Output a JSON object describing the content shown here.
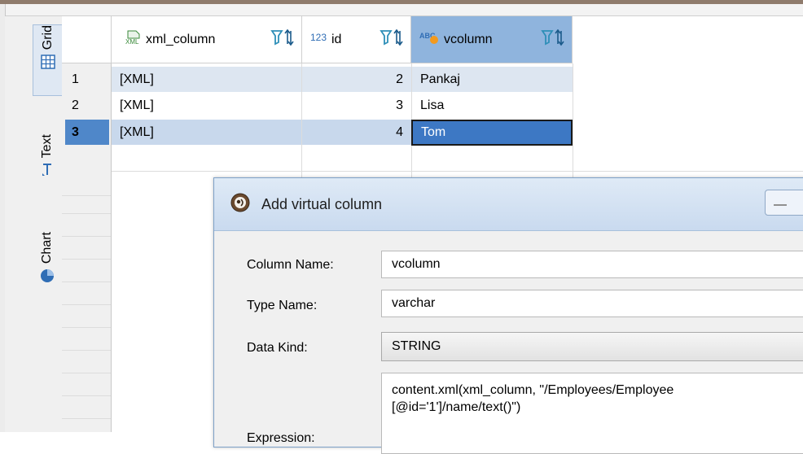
{
  "side_tabs": [
    {
      "label": "Grid",
      "icon": "grid-icon",
      "active": true
    },
    {
      "label": "Text",
      "icon": "text-icon",
      "active": false
    },
    {
      "label": "Chart",
      "icon": "pie-chart-icon",
      "active": false
    }
  ],
  "grid": {
    "columns": [
      {
        "label": "xml_column",
        "icon": "xml-type-icon",
        "type_badge": "XML"
      },
      {
        "label": "id",
        "icon": "number-type-icon",
        "type_badge": "123"
      },
      {
        "label": "vcolumn",
        "icon": "string-type-icon",
        "type_badge": "ABC"
      }
    ],
    "rows": [
      {
        "num": "1",
        "xml_column": "[XML]",
        "id": "2",
        "vcolumn": "Pankaj"
      },
      {
        "num": "2",
        "xml_column": "[XML]",
        "id": "3",
        "vcolumn": "Lisa"
      },
      {
        "num": "3",
        "xml_column": "[XML]",
        "id": "4",
        "vcolumn": "Tom"
      }
    ],
    "selected_row": 3,
    "selected_column": "vcolumn"
  },
  "dialog": {
    "title": "Add virtual column",
    "fields": {
      "column_name_label": "Column Name:",
      "column_name_value": "vcolumn",
      "type_name_label": "Type Name:",
      "type_name_value": "varchar",
      "data_kind_label": "Data Kind:",
      "data_kind_value": "STRING",
      "expression_label": "Expression:",
      "expression_value": "content.xml(xml_column, \"/Employees/Employee\n[@id='1']/name/text()\")"
    }
  },
  "colors": {
    "selection": "#4f87c9",
    "header_selected": "#8fb4dd",
    "focus_cell": "#3d78c4"
  }
}
